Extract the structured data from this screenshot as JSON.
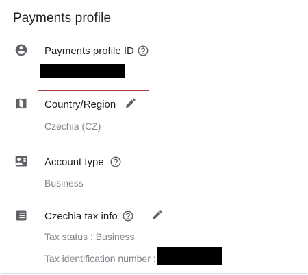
{
  "page": {
    "title": "Payments profile"
  },
  "sections": {
    "profile_id": {
      "label": "Payments profile ID",
      "help_icon": "help-circle-icon",
      "value_redacted": true
    },
    "country": {
      "label": "Country/Region",
      "value": "Czechia (CZ)",
      "edit_icon": "pencil-icon",
      "highlighted": true
    },
    "account_type": {
      "label": "Account type",
      "value": "Business",
      "help_icon": "help-circle-icon"
    },
    "tax_info": {
      "label": "Czechia tax info",
      "status_label": "Tax status",
      "status_value": "Business",
      "tax_id_label": "Tax identification number",
      "tax_id_redacted": true
    }
  },
  "colors": {
    "text_primary": "#202124",
    "text_secondary": "#80868b",
    "icon": "#5f6368",
    "highlight_border": "#a94442",
    "redaction": "#000000"
  }
}
